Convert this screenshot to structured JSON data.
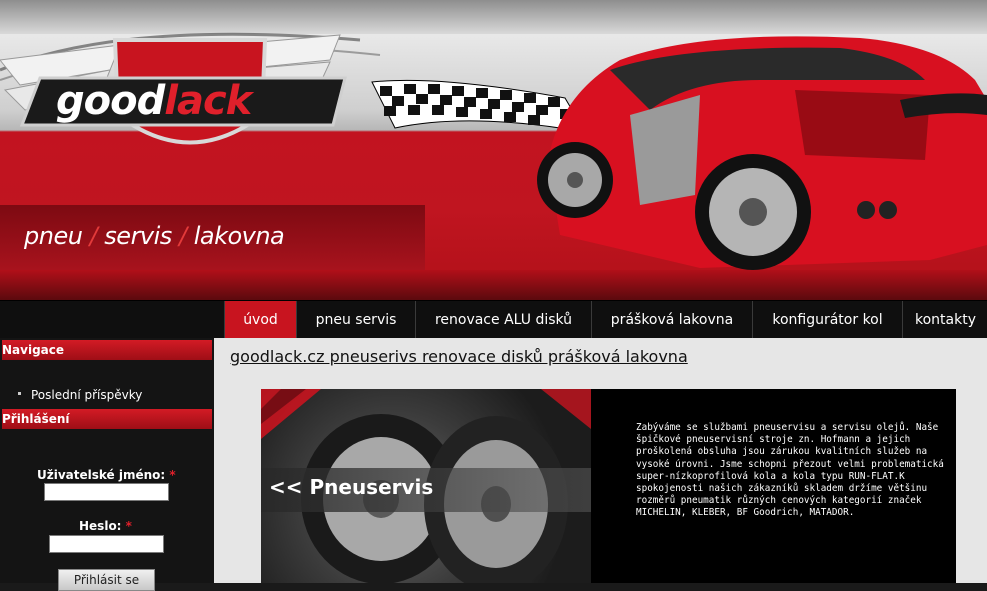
{
  "header": {
    "logo_main": "good",
    "logo_accent": "lack",
    "tagline": [
      "pneu",
      "/",
      "servis",
      "/",
      "lakovna"
    ],
    "flag_colors": [
      "#ffffff",
      "#111111"
    ],
    "car_color": "#d81020"
  },
  "menu": {
    "items": [
      {
        "label": "úvod",
        "active": true
      },
      {
        "label": "pneu servis",
        "active": false
      },
      {
        "label": "renovace ALU disků",
        "active": false
      },
      {
        "label": "prášková lakovna",
        "active": false
      },
      {
        "label": "konfigurátor kol",
        "active": false
      },
      {
        "label": "kontakty",
        "active": false
      }
    ],
    "active_color": "#c8141f"
  },
  "sidebar": {
    "nav_heading": "Navigace",
    "nav_items": [
      "Poslední příspěvky"
    ],
    "login_heading": "Přihlášení",
    "username_label": "Uživatelské jméno:",
    "password_label": "Heslo:",
    "required_mark": "*",
    "username_value": "",
    "password_value": "",
    "login_button": "Přihlásit se"
  },
  "main": {
    "title": "goodlack.cz pneuserivs renovace disků prášková lakovna",
    "promo_heading": "<< Pneuservis",
    "promo_text": "Zabýváme se službami pneuservisu a servisu olejů. Naše špičkové pneuservisní stroje zn. Hofmann a jejich proškolená obsluha jsou zárukou kvalitních služeb na vysoké úrovni. Jsme schopni přezout velmi problematická super-nízkoprofilová kola a kola typu RUN-FLAT.K spokojenosti našich zákazníků skladem držíme většinu rozměrů pneumatik různých cenových kategorií značek MICHELIN, KLEBER, BF Goodrich, MATADOR."
  }
}
